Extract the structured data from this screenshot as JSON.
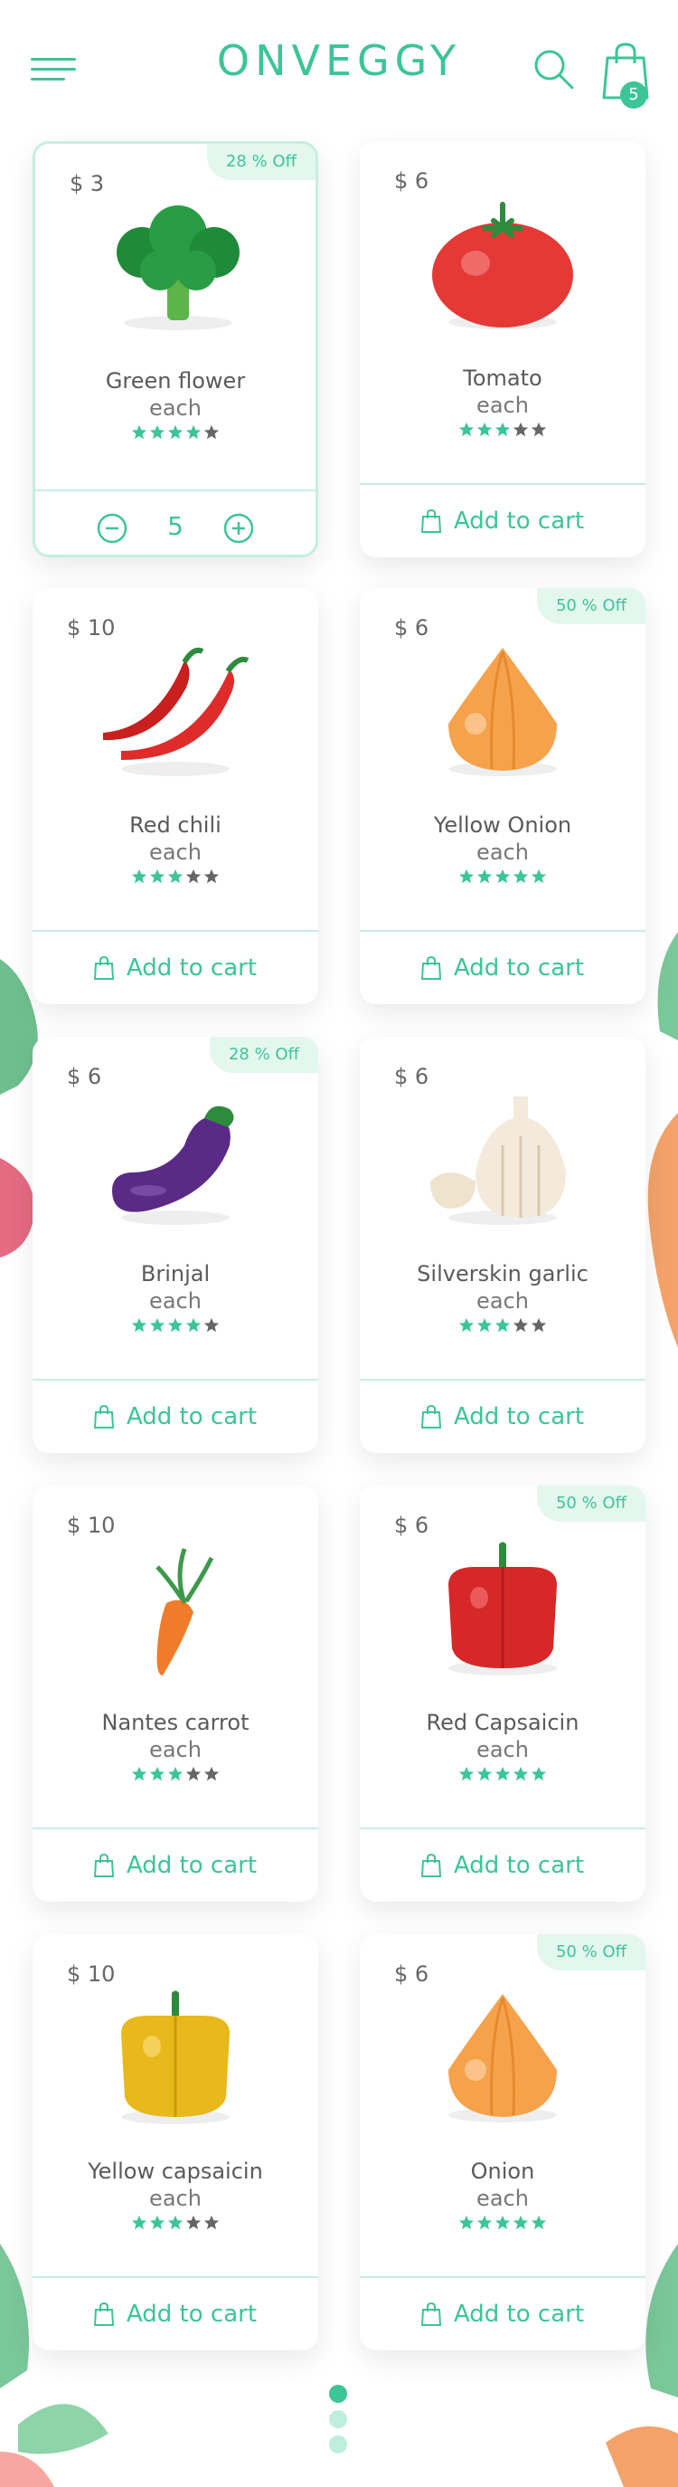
{
  "app": {
    "logo": "ONVEGGY",
    "cart_count": "5"
  },
  "colors": {
    "accent": "#3cc596",
    "accent_light": "#e4f7ef",
    "star_on": "#3cc596",
    "star_off": "#666666"
  },
  "products": [
    {
      "name": "Green flower",
      "price": "$ 3",
      "unit": "each",
      "badge": "28 % Off",
      "rating": 4,
      "qty": "5",
      "icon": "broccoli"
    },
    {
      "name": "Tomato",
      "price": "$ 6",
      "unit": "each",
      "badge": "",
      "rating": 3,
      "cta": "Add to cart",
      "icon": "tomato"
    },
    {
      "name": "Red chili",
      "price": "$ 10",
      "unit": "each",
      "badge": "",
      "rating": 3,
      "cta": "Add to cart",
      "icon": "red-chili"
    },
    {
      "name": "Yellow Onion",
      "price": "$ 6",
      "unit": "each",
      "badge": "50 % Off",
      "rating": 5,
      "cta": "Add to cart",
      "icon": "onion"
    },
    {
      "name": "Brinjal",
      "price": "$ 6",
      "unit": "each",
      "badge": "28 % Off",
      "rating": 4,
      "cta": "Add to cart",
      "icon": "eggplant"
    },
    {
      "name": "Silverskin garlic",
      "price": "$ 6",
      "unit": "each",
      "badge": "",
      "rating": 3,
      "cta": "Add to cart",
      "icon": "garlic"
    },
    {
      "name": "Nantes carrot",
      "price": "$ 10",
      "unit": "each",
      "badge": "",
      "rating": 3,
      "cta": "Add to cart",
      "icon": "carrot"
    },
    {
      "name": "Red Capsaicin",
      "price": "$ 6",
      "unit": "each",
      "badge": "50 % Off",
      "rating": 5,
      "cta": "Add to cart",
      "icon": "red-pepper"
    },
    {
      "name": "Yellow capsaicin",
      "price": "$ 10",
      "unit": "each",
      "badge": "",
      "rating": 3,
      "cta": "Add to cart",
      "icon": "yellow-pepper"
    },
    {
      "name": "Onion",
      "price": "$ 6",
      "unit": "each",
      "badge": "50 % Off",
      "rating": 5,
      "cta": "Add to cart",
      "icon": "onion"
    }
  ],
  "pagination": {
    "pages": 3,
    "current": 1
  }
}
